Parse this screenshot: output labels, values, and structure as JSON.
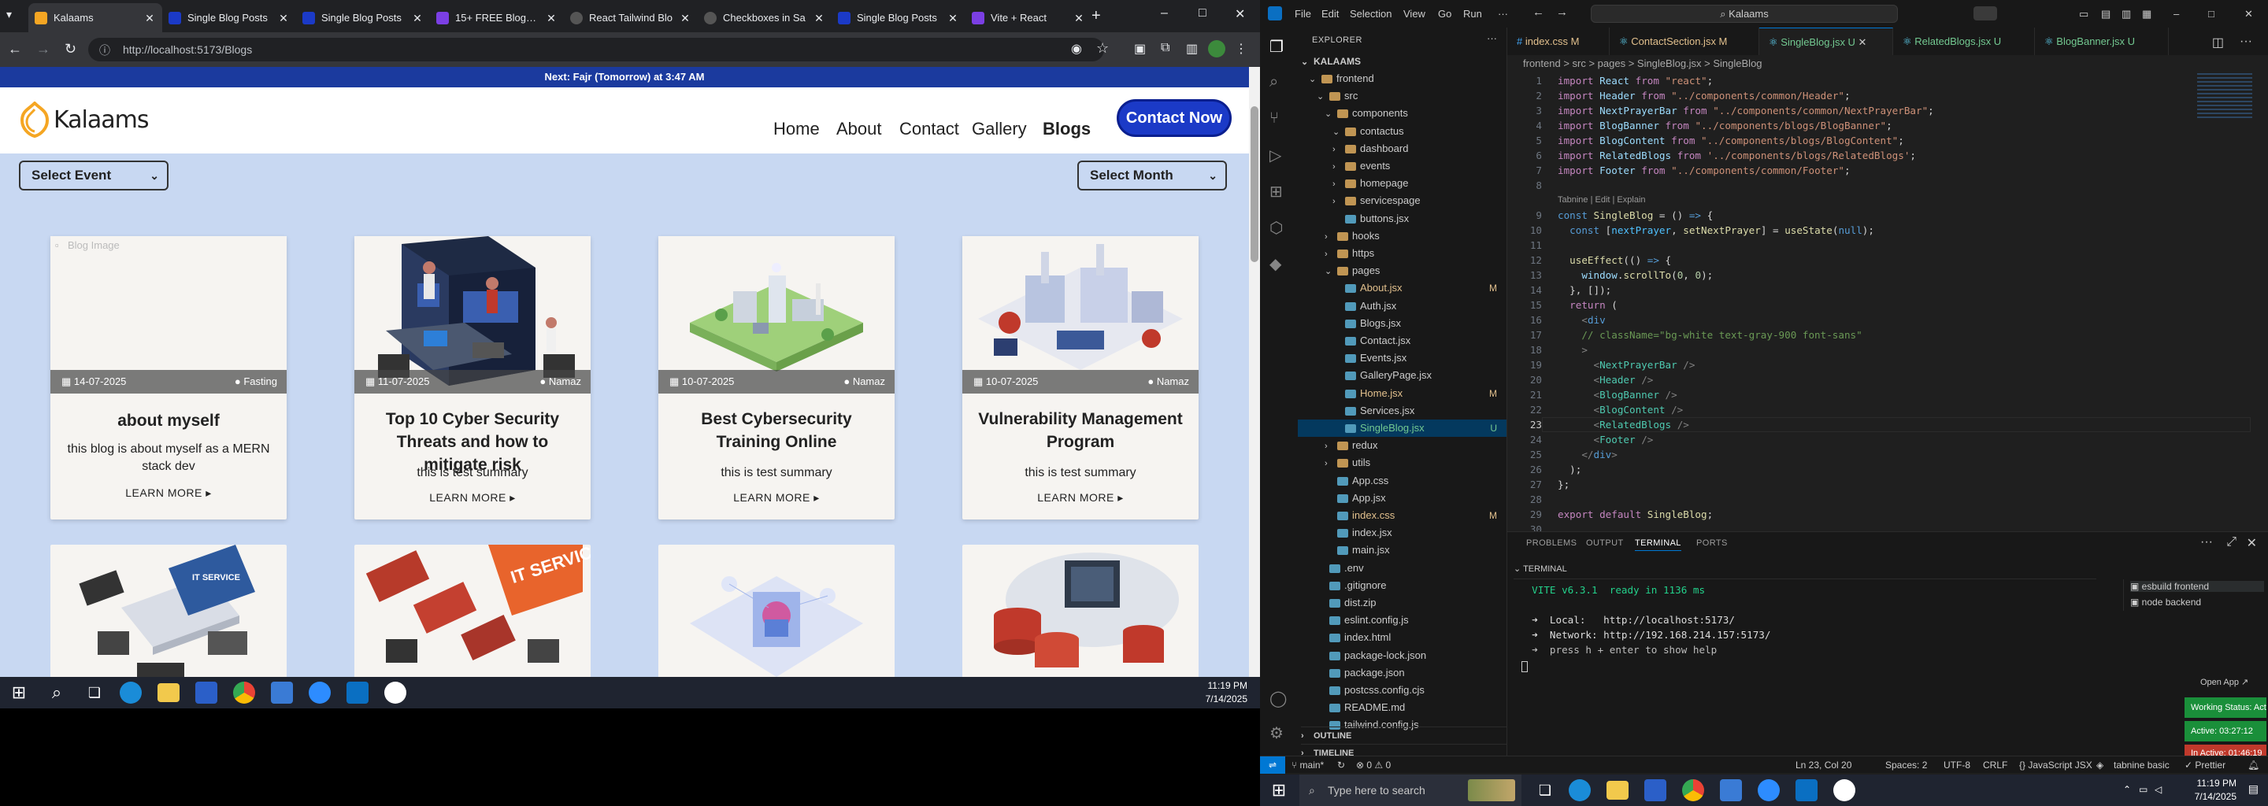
{
  "browser": {
    "tabs": [
      {
        "title": "Kalaams",
        "active": true,
        "color": "#f5a623"
      },
      {
        "title": "Single Blog Posts",
        "active": false,
        "color": "#1b3ac7"
      },
      {
        "title": "Single Blog Posts",
        "active": false,
        "color": "#1b3ac7"
      },
      {
        "title": "15+ FREE Blog Wi",
        "active": false,
        "color": "#7b3fe4"
      },
      {
        "title": "React Tailwind Blo",
        "active": false,
        "color": "#444"
      },
      {
        "title": "Checkboxes in Sa",
        "active": false,
        "color": "#444"
      },
      {
        "title": "Single Blog Posts",
        "active": false,
        "color": "#1b3ac7"
      },
      {
        "title": "Vite + React",
        "active": false,
        "color": "#7b3fe4"
      }
    ],
    "url": "http://localhost:5173/Blogs",
    "window_controls": {
      "minimize": "–",
      "maximize": "□",
      "close": "✕"
    }
  },
  "site": {
    "prayer_bar": "Next: Fajr (Tomorrow) at 3:47 AM",
    "logo_text": "Kalaams",
    "nav": [
      "Home",
      "About",
      "Contact",
      "Gallery",
      "Blogs"
    ],
    "contact_button": "Contact Now",
    "select_event": "Select Event",
    "select_month": "Select Month",
    "cards": [
      {
        "date": "14-07-2025",
        "category": "Fasting",
        "title": "about myself",
        "summary": "this blog is about myself as a MERN stack dev",
        "more": "LEARN MORE ▸",
        "alt": "Blog Image"
      },
      {
        "date": "11-07-2025",
        "category": "Namaz",
        "title": "Top 10 Cyber Security Threats and how to mitigate risk",
        "summary": "this is test summary",
        "more": "LEARN MORE ▸"
      },
      {
        "date": "10-07-2025",
        "category": "Namaz",
        "title": "Best Cybersecurity Training Online",
        "summary": "this is test summary",
        "more": "LEARN MORE ▸"
      },
      {
        "date": "10-07-2025",
        "category": "Namaz",
        "title": "Vulnerability Management Program",
        "summary": "this is test summary",
        "more": "LEARN MORE ▸"
      }
    ],
    "second_row_labels": [
      "IT SERVICE",
      "IT SERVICE"
    ]
  },
  "taskbar_left": {
    "time": "11:19 PM",
    "date": "7/14/2025"
  },
  "vscode": {
    "search": "Kalaams",
    "menu": [
      "File",
      "Edit",
      "Selection",
      "View",
      "Go",
      "Run",
      "···"
    ],
    "explorer_title": "EXPLORER",
    "root": "KALAAMS",
    "tree": [
      {
        "label": "frontend",
        "depth": 1,
        "type": "folder-open"
      },
      {
        "label": "src",
        "depth": 2,
        "type": "folder-open"
      },
      {
        "label": "components",
        "depth": 3,
        "type": "folder-open"
      },
      {
        "label": "contactus",
        "depth": 4,
        "type": "folder-open"
      },
      {
        "label": "dashboard",
        "depth": 4,
        "type": "folder"
      },
      {
        "label": "events",
        "depth": 4,
        "type": "folder"
      },
      {
        "label": "homepage",
        "depth": 4,
        "type": "folder"
      },
      {
        "label": "servicespage",
        "depth": 4,
        "type": "folder"
      },
      {
        "label": "buttons.jsx",
        "depth": 4,
        "type": "file"
      },
      {
        "label": "hooks",
        "depth": 3,
        "type": "folder"
      },
      {
        "label": "https",
        "depth": 3,
        "type": "folder"
      },
      {
        "label": "pages",
        "depth": 3,
        "type": "folder-open"
      },
      {
        "label": "About.jsx",
        "depth": 4,
        "type": "file",
        "badge": "M"
      },
      {
        "label": "Auth.jsx",
        "depth": 4,
        "type": "file"
      },
      {
        "label": "Blogs.jsx",
        "depth": 4,
        "type": "file"
      },
      {
        "label": "Contact.jsx",
        "depth": 4,
        "type": "file"
      },
      {
        "label": "Events.jsx",
        "depth": 4,
        "type": "file"
      },
      {
        "label": "GalleryPage.jsx",
        "depth": 4,
        "type": "file"
      },
      {
        "label": "Home.jsx",
        "depth": 4,
        "type": "file",
        "badge": "M"
      },
      {
        "label": "Services.jsx",
        "depth": 4,
        "type": "file"
      },
      {
        "label": "SingleBlog.jsx",
        "depth": 4,
        "type": "file",
        "badge": "U",
        "selected": true
      },
      {
        "label": "redux",
        "depth": 3,
        "type": "folder"
      },
      {
        "label": "utils",
        "depth": 3,
        "type": "folder"
      },
      {
        "label": "App.css",
        "depth": 3,
        "type": "file"
      },
      {
        "label": "App.jsx",
        "depth": 3,
        "type": "file"
      },
      {
        "label": "index.css",
        "depth": 3,
        "type": "file",
        "badge": "M"
      },
      {
        "label": "index.jsx",
        "depth": 3,
        "type": "file"
      },
      {
        "label": "main.jsx",
        "depth": 3,
        "type": "file"
      },
      {
        "label": ".env",
        "depth": 2,
        "type": "file"
      },
      {
        "label": ".gitignore",
        "depth": 2,
        "type": "file"
      },
      {
        "label": "dist.zip",
        "depth": 2,
        "type": "file"
      },
      {
        "label": "eslint.config.js",
        "depth": 2,
        "type": "file"
      },
      {
        "label": "index.html",
        "depth": 2,
        "type": "file"
      },
      {
        "label": "package-lock.json",
        "depth": 2,
        "type": "file"
      },
      {
        "label": "package.json",
        "depth": 2,
        "type": "file"
      },
      {
        "label": "postcss.config.cjs",
        "depth": 2,
        "type": "file"
      },
      {
        "label": "README.md",
        "depth": 2,
        "type": "file"
      },
      {
        "label": "tailwind.config.js",
        "depth": 2,
        "type": "file"
      }
    ],
    "outline": "OUTLINE",
    "timeline": "TIMELINE",
    "editor_tabs": [
      {
        "label": "index.css M",
        "active": false
      },
      {
        "label": "ContactSection.jsx M",
        "active": false
      },
      {
        "label": "SingleBlog.jsx U",
        "active": true
      },
      {
        "label": "RelatedBlogs.jsx U",
        "active": false
      },
      {
        "label": "BlogBanner.jsx U",
        "active": false
      }
    ],
    "breadcrumb": "frontend > src > pages > SingleBlog.jsx > SingleBlog",
    "codelens": "Tabnine | Edit | Explain",
    "panel_tabs": [
      "PROBLEMS",
      "OUTPUT",
      "TERMINAL",
      "PORTS"
    ],
    "terminal_label": "TERMINAL",
    "terminal_lines": [
      "  VITE v6.3.1  ready in 1136 ms",
      "",
      "  ➜  Local:   http://localhost:5173/",
      "  ➜  Network: http://192.168.214.157:5173/",
      "  ➜  press h + enter to show help"
    ],
    "terminals": [
      "esbuild frontend",
      "node backend"
    ],
    "open_app": "Open App ↗",
    "working_status": "Working Status: Active",
    "active_time": "Active: 03:27:12",
    "inactive_time": "In Active: 01:46:19",
    "status": {
      "branch": "main*",
      "errors": "⊗ 0 ⚠ 0",
      "position": "Ln 23, Col 20",
      "spaces": "Spaces: 2",
      "encoding": "UTF-8",
      "eol": "CRLF",
      "language": "JavaScript JSX",
      "tabnine": "tabnine basic",
      "prettier": "✓ Prettier"
    }
  },
  "taskbar_right": {
    "search": "Type here to search",
    "time": "11:19 PM",
    "date": "7/14/2025"
  }
}
